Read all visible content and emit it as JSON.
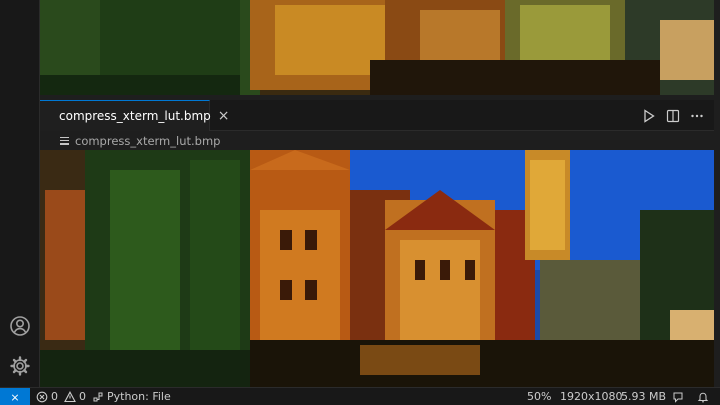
{
  "editor": {
    "tab": {
      "label": "compress_xterm_lut.bmp",
      "close_glyph": "×"
    },
    "breadcrumb": {
      "file": "compress_xterm_lut.bmp"
    },
    "tab_actions": [
      "run-icon",
      "split-editor-icon",
      "more-actions-icon"
    ]
  },
  "activity_bar": {
    "bottom_icons": [
      "account-icon",
      "manage-gear-icon"
    ]
  },
  "status_bar": {
    "remote_glyph": "⨯",
    "errors": "0",
    "warnings": "0",
    "language_mode": "Python: File",
    "zoom": "50%",
    "dimensions": "1920x1080",
    "file_size": "5.93 MB"
  },
  "colors": {
    "accent": "#0078d4",
    "editor_bg": "#1e1e1e",
    "chrome_bg": "#181818"
  }
}
